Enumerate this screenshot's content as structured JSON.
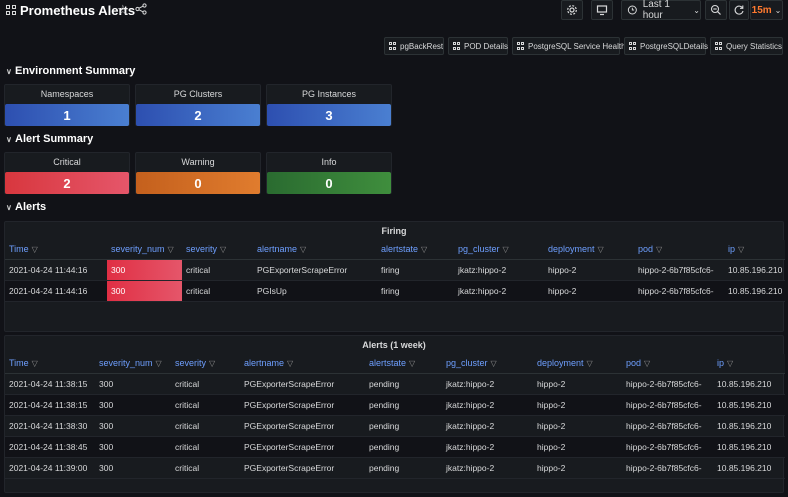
{
  "header": {
    "title": "Prometheus Alerts",
    "time_range": "Last 1 hour",
    "refresh": "15m"
  },
  "links": [
    {
      "label": "pgBackRest"
    },
    {
      "label": "POD Details"
    },
    {
      "label": "PostgreSQL Service Health"
    },
    {
      "label": "PostgreSQLDetails"
    },
    {
      "label": "Query Statistics"
    }
  ],
  "sections": {
    "env": "Environment Summary",
    "alert": "Alert Summary",
    "alerts": "Alerts"
  },
  "env_stats": [
    {
      "label": "Namespaces",
      "value": "1"
    },
    {
      "label": "PG Clusters",
      "value": "2"
    },
    {
      "label": "PG Instances",
      "value": "3"
    }
  ],
  "alert_stats": [
    {
      "label": "Critical",
      "value": "2",
      "color": "#e02f44"
    },
    {
      "label": "Warning",
      "value": "0",
      "color": "#ff780a"
    },
    {
      "label": "Info",
      "value": "0",
      "color": "#37872d"
    }
  ],
  "firing": {
    "title": "Firing",
    "columns": [
      "Time",
      "severity_num",
      "severity",
      "alertname",
      "alertstate",
      "pg_cluster",
      "deployment",
      "pod",
      "ip"
    ],
    "rows": [
      [
        "2021-04-24 11:44:16",
        "300",
        "critical",
        "PGExporterScrapeError",
        "firing",
        "jkatz:hippo-2",
        "hippo-2",
        "hippo-2-6b7f85cfc6-",
        "10.85.196.210"
      ],
      [
        "2021-04-24 11:44:16",
        "300",
        "critical",
        "PGIsUp",
        "firing",
        "jkatz:hippo-2",
        "hippo-2",
        "hippo-2-6b7f85cfc6-",
        "10.85.196.210"
      ]
    ]
  },
  "week": {
    "title": "Alerts (1 week)",
    "columns": [
      "Time",
      "severity_num",
      "severity",
      "alertname",
      "alertstate",
      "pg_cluster",
      "deployment",
      "pod",
      "ip"
    ],
    "rows": [
      [
        "2021-04-24 11:38:15",
        "300",
        "critical",
        "PGExporterScrapeError",
        "pending",
        "jkatz:hippo-2",
        "hippo-2",
        "hippo-2-6b7f85cfc6-",
        "10.85.196.210"
      ],
      [
        "2021-04-24 11:38:15",
        "300",
        "critical",
        "PGExporterScrapeError",
        "pending",
        "jkatz:hippo-2",
        "hippo-2",
        "hippo-2-6b7f85cfc6-",
        "10.85.196.210"
      ],
      [
        "2021-04-24 11:38:30",
        "300",
        "critical",
        "PGExporterScrapeError",
        "pending",
        "jkatz:hippo-2",
        "hippo-2",
        "hippo-2-6b7f85cfc6-",
        "10.85.196.210"
      ],
      [
        "2021-04-24 11:38:45",
        "300",
        "critical",
        "PGExporterScrapeError",
        "pending",
        "jkatz:hippo-2",
        "hippo-2",
        "hippo-2-6b7f85cfc6-",
        "10.85.196.210"
      ],
      [
        "2021-04-24 11:39:00",
        "300",
        "critical",
        "PGExporterScrapeError",
        "pending",
        "jkatz:hippo-2",
        "hippo-2",
        "hippo-2-6b7f85cfc6-",
        "10.85.196.210"
      ]
    ]
  }
}
